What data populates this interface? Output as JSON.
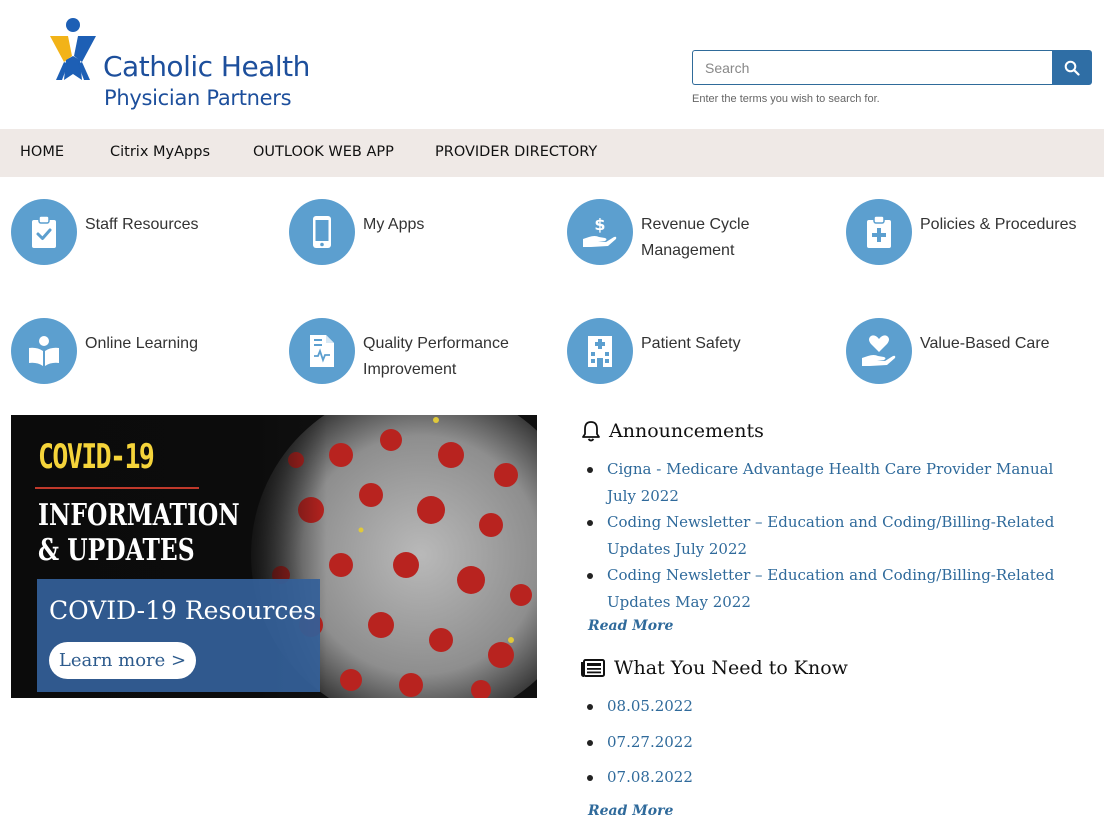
{
  "header": {
    "logo_line1": "Catholic Health",
    "logo_line2": "Physician Partners",
    "search": {
      "placeholder": "Search",
      "hint": "Enter the terms you wish to search for."
    }
  },
  "nav": {
    "items": [
      {
        "label": "HOME"
      },
      {
        "label": "Citrix MyApps"
      },
      {
        "label": "OUTLOOK WEB APP"
      },
      {
        "label": "PROVIDER DIRECTORY"
      }
    ]
  },
  "tiles": [
    {
      "label": "Staff Resources",
      "icon": "clipboard-check-icon"
    },
    {
      "label": "My Apps",
      "icon": "mobile-phone-icon"
    },
    {
      "label": "Revenue Cycle Management",
      "icon": "hand-dollar-icon"
    },
    {
      "label": "Policies & Procedures",
      "icon": "clipboard-plus-icon"
    },
    {
      "label": "Online Learning",
      "icon": "book-reader-icon"
    },
    {
      "label": "Quality Performance Improvement",
      "icon": "file-chart-icon"
    },
    {
      "label": "Patient Safety",
      "icon": "hospital-icon"
    },
    {
      "label": "Value-Based Care",
      "icon": "hand-heart-icon"
    }
  ],
  "covid_banner": {
    "title": "COVID-19",
    "subtitle_line1": "INFORMATION",
    "subtitle_line2": "& UPDATES",
    "box_title": "COVID-19 Resources",
    "button_label": "Learn more >"
  },
  "announcements": {
    "heading": "Announcements",
    "items": [
      "Cigna - Medicare Advantage Health Care Provider Manual July 2022",
      "Coding Newsletter – Education and Coding/Billing-Related Updates July 2022",
      "Coding Newsletter – Education and Coding/Billing-Related Updates May 2022"
    ],
    "read_more": "Read More"
  },
  "need_to_know": {
    "heading": "What You Need to Know",
    "items": [
      "08.05.2022",
      "07.27.2022",
      "07.08.2022"
    ],
    "read_more": "Read More"
  },
  "colors": {
    "brand_blue": "#1d4f9c",
    "tile_blue": "#5c9fcf",
    "link_blue": "#2f6a9b",
    "nav_bg": "#efe9e6",
    "logo_yellow": "#f2b318"
  }
}
